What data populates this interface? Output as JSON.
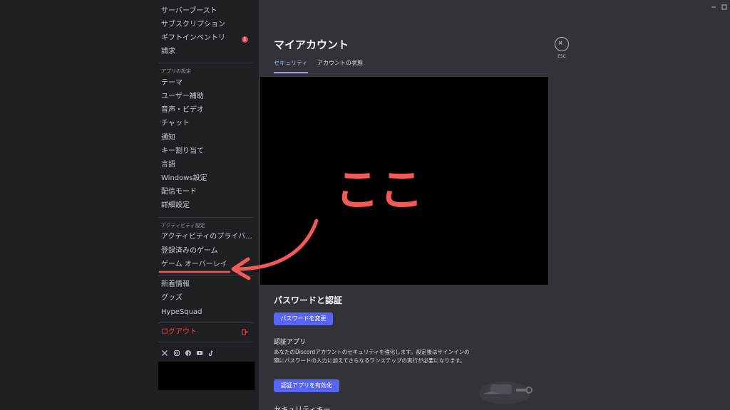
{
  "sidebar": {
    "billing_items": [
      {
        "label": "サーバーブースト"
      },
      {
        "label": "サブスクリプション"
      },
      {
        "label": "ギフトインベントリ",
        "badge": "1"
      },
      {
        "label": "請求"
      }
    ],
    "app_settings_header": "アプリの設定",
    "app_settings_items": [
      {
        "label": "テーマ"
      },
      {
        "label": "ユーザー補助"
      },
      {
        "label": "音声・ビデオ"
      },
      {
        "label": "チャット"
      },
      {
        "label": "通知"
      },
      {
        "label": "キー割り当て"
      },
      {
        "label": "言語"
      },
      {
        "label": "Windows設定"
      },
      {
        "label": "配信モード"
      },
      {
        "label": "詳細設定"
      }
    ],
    "activity_header": "アクティビティ設定",
    "activity_items": [
      {
        "label": "アクティビティのプライバ..."
      },
      {
        "label": "登録済みのゲーム"
      },
      {
        "label": "ゲーム オーバーレイ"
      }
    ],
    "misc_items": [
      {
        "label": "新着情報"
      },
      {
        "label": "グッズ"
      },
      {
        "label": "HypeSquad"
      }
    ],
    "logout_label": "ログアウト",
    "social_icons": [
      "x-icon",
      "instagram-icon",
      "facebook-icon",
      "youtube-icon",
      "tiktok-icon"
    ]
  },
  "main": {
    "title": "マイアカウント",
    "tabs": [
      {
        "label": "セキュリティ",
        "active": true
      },
      {
        "label": "アカウントの状態",
        "active": false
      }
    ],
    "esc_label": "ESC",
    "annotation_text": "ここ",
    "password_section": {
      "title": "パスワードと認証",
      "change_password_button": "パスワードを変更"
    },
    "auth_app": {
      "title": "認証アプリ",
      "description": "あなたのDiscordアカウントのセキュリティを強化します。設定後はサインインの際にパスワードの入力に加えてさらなるワンステップの実行が必要になります。",
      "enable_button": "認証アプリを有効化"
    },
    "security_key_title": "セキュリティキー"
  },
  "colors": {
    "sidebar_bg": "#1e1f22",
    "content_bg": "#313338",
    "accent": "#5865f2",
    "danger": "#f23f43",
    "annotation": "#f25a5a"
  }
}
